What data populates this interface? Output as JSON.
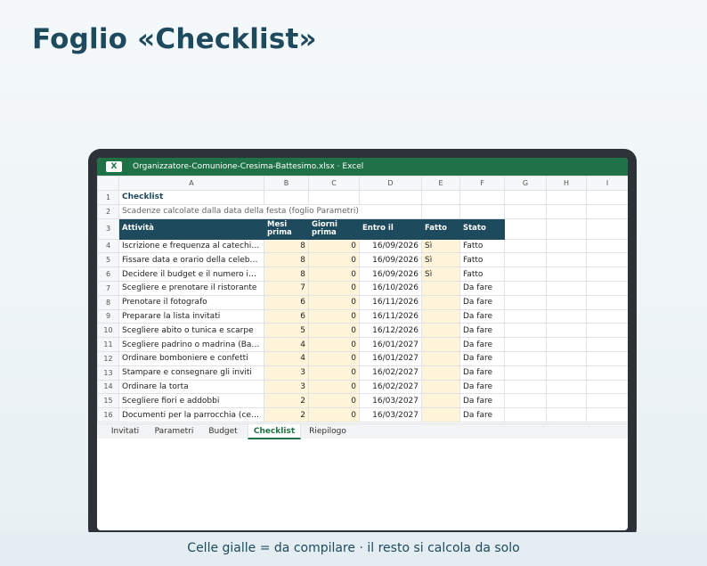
{
  "slide": {
    "title": "Foglio «Checklist»",
    "caption": "Celle gialle = da compilare · il resto si calcola da solo"
  },
  "window": {
    "app_icon": "X",
    "title": "Organizzatore-Comunione-Cresima-Battesimo.xlsx · Excel"
  },
  "sheet": {
    "columns": [
      "A",
      "B",
      "C",
      "D",
      "E",
      "F",
      "G",
      "H",
      "I"
    ],
    "title": "Checklist",
    "subtitle": "Scadenze calcolate dalla data della festa (foglio Parametri)",
    "headers": {
      "activity": "Attività",
      "months_before": "Mesi prima",
      "days_before": "Giorni prima",
      "due_by": "Entro il",
      "done": "Fatto",
      "status": "Stato"
    },
    "rows": [
      {
        "n": "4",
        "activity": "Iscrizione e frequenza al catechismo",
        "months": "8",
        "days": "0",
        "due": "16/09/2026",
        "done": "Sì",
        "status": "Fatto"
      },
      {
        "n": "5",
        "activity": "Fissare data e orario della celebrazione",
        "months": "8",
        "days": "0",
        "due": "16/09/2026",
        "done": "Sì",
        "status": "Fatto"
      },
      {
        "n": "6",
        "activity": "Decidere il budget e il numero invitati",
        "months": "8",
        "days": "0",
        "due": "16/09/2026",
        "done": "Sì",
        "status": "Fatto"
      },
      {
        "n": "7",
        "activity": "Scegliere e prenotare il ristorante",
        "months": "7",
        "days": "0",
        "due": "16/10/2026",
        "done": "",
        "status": "Da fare"
      },
      {
        "n": "8",
        "activity": "Prenotare il fotografo",
        "months": "6",
        "days": "0",
        "due": "16/11/2026",
        "done": "",
        "status": "Da fare"
      },
      {
        "n": "9",
        "activity": "Preparare la lista invitati",
        "months": "6",
        "days": "0",
        "due": "16/11/2026",
        "done": "",
        "status": "Da fare"
      },
      {
        "n": "10",
        "activity": "Scegliere abito o tunica e scarpe",
        "months": "5",
        "days": "0",
        "due": "16/12/2026",
        "done": "",
        "status": "Da fare"
      },
      {
        "n": "11",
        "activity": "Scegliere padrino o madrina (Battesimo)",
        "months": "4",
        "days": "0",
        "due": "16/01/2027",
        "done": "",
        "status": "Da fare"
      },
      {
        "n": "12",
        "activity": "Ordinare bomboniere e confetti",
        "months": "4",
        "days": "0",
        "due": "16/01/2027",
        "done": "",
        "status": "Da fare"
      },
      {
        "n": "13",
        "activity": "Stampare e consegnare gli inviti",
        "months": "3",
        "days": "0",
        "due": "16/02/2027",
        "done": "",
        "status": "Da fare"
      },
      {
        "n": "14",
        "activity": "Ordinare la torta",
        "months": "3",
        "days": "0",
        "due": "16/02/2027",
        "done": "",
        "status": "Da fare"
      },
      {
        "n": "15",
        "activity": "Scegliere fiori e addobbi",
        "months": "2",
        "days": "0",
        "due": "16/03/2027",
        "done": "",
        "status": "Da fare"
      },
      {
        "n": "16",
        "activity": "Documenti per la parrocchia (certificati)",
        "months": "2",
        "days": "0",
        "due": "16/03/2027",
        "done": "",
        "status": "Da fare"
      }
    ]
  },
  "tabs": [
    "Invitati",
    "Parametri",
    "Budget",
    "Checklist",
    "Riepilogo"
  ],
  "active_tab": "Checklist",
  "colors": {
    "excel_green": "#1f7246",
    "header_navy": "#1e4a5e",
    "input_yellow": "#fdf4d9"
  }
}
